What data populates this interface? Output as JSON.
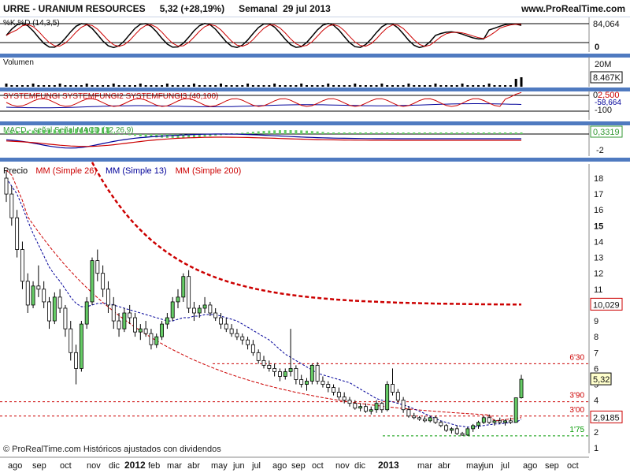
{
  "header": {
    "title": "URRE - URANIUM RESOURCES",
    "quote": "5,32 (+28,19%)",
    "period": "Semanal  29 jul 2013",
    "site": "www.ProRealTime.com"
  },
  "footer": "© ProRealTime.com Históricos ajustados con dividendos",
  "colors": {
    "panel_separator": "#4f7ac0",
    "up_candle": "#66cc66",
    "down_candle": "#ffffff",
    "ma26": "#cc0000",
    "ma13": "#000099",
    "ma200": "#cc0000",
    "volume": "#000000",
    "stoch_k": "#000000",
    "stoch_d": "#cc0000",
    "systemfungi2": "#cc0000",
    "systemfungi3": "#000099",
    "macd_hist": "#66cc66",
    "level_line": "#cc0000",
    "support_line": "#009900"
  },
  "chart_data": [
    {
      "type": "line",
      "panel": "stochastic",
      "title": "%K %D (14,3,5)",
      "yticks": [
        "84,064",
        "0"
      ],
      "last_value_label": "84,064",
      "series_names": [
        "%K",
        "%D"
      ]
    },
    {
      "type": "bar",
      "panel": "volume",
      "title": "Volumen",
      "yticks": [
        "20M"
      ],
      "last_value_label": "8.467K"
    },
    {
      "type": "line",
      "panel": "systemfungi",
      "title": "SYSTEMFUNGI SYSTEMFUNGI2 SYSTEMFUNGI3 (40,100)",
      "yticks": [
        "0",
        "-100"
      ],
      "labels": [
        "2,500",
        "-58,664"
      ]
    },
    {
      "type": "bar",
      "panel": "macd",
      "title": "MACD - señal Señal MACD (12,26,9)",
      "yticks": [
        "-2"
      ],
      "last_value_label": "0,3319"
    },
    {
      "type": "line",
      "panel": "price",
      "title": "Precio MM (Simple 26) MM (Simple 13) MM (Simple 200)",
      "legend": [
        "Precio",
        "MM (Simple 26)",
        "MM (Simple 13)",
        "MM (Simple 200)"
      ],
      "ylim": [
        1,
        18
      ],
      "yticks": [
        1,
        2,
        3,
        4,
        5,
        6,
        7,
        8,
        9,
        10,
        11,
        12,
        13,
        14,
        15,
        16,
        17,
        18
      ],
      "ytick_labels": [
        "1",
        "2",
        "3",
        "4",
        "5",
        "6",
        "7",
        "8",
        "9",
        "10",
        "11",
        "12",
        "13",
        "14",
        "15",
        "16",
        "17",
        "18"
      ],
      "last_price": "5,32",
      "ma200_last": "10,029",
      "ma26_last": "2,9185",
      "x_labels": [
        "ago",
        "sep",
        "oct",
        "nov",
        "dic",
        "2012",
        "feb",
        "mar",
        "abr",
        "may",
        "jun",
        "jul",
        "ago",
        "sep",
        "oct",
        "nov",
        "dic",
        "2013",
        "mar",
        "abr",
        "may",
        "jun",
        "jul",
        "ago",
        "sep",
        "oct"
      ],
      "horizontal_levels": [
        {
          "value": 6.3,
          "label": "6'30",
          "style": "red-dashed"
        },
        {
          "value": 3.9,
          "label": "3'90",
          "style": "red-dashed"
        },
        {
          "value": 3.0,
          "label": "3'00",
          "style": "red-dashed"
        },
        {
          "value": 1.75,
          "label": "1'75",
          "style": "green-dashed"
        }
      ],
      "ohlc_weekly": [
        [
          18.0,
          18.5,
          16.5,
          17.0
        ],
        [
          17.0,
          17.5,
          15.0,
          15.5
        ],
        [
          15.5,
          16.0,
          13.0,
          13.5
        ],
        [
          13.5,
          14.0,
          11.0,
          11.5
        ],
        [
          11.5,
          12.0,
          9.5,
          10.0
        ],
        [
          10.0,
          11.5,
          9.8,
          11.2
        ],
        [
          11.2,
          12.5,
          10.5,
          11.0
        ],
        [
          11.0,
          11.5,
          9.8,
          10.2
        ],
        [
          10.2,
          10.5,
          8.5,
          9.0
        ],
        [
          9.0,
          10.8,
          8.8,
          10.5
        ],
        [
          10.5,
          11.0,
          9.5,
          9.8
        ],
        [
          9.8,
          10.0,
          8.0,
          8.5
        ],
        [
          8.5,
          9.0,
          6.5,
          7.0
        ],
        [
          7.0,
          7.5,
          5.0,
          6.0
        ],
        [
          6.0,
          9.0,
          5.8,
          8.8
        ],
        [
          8.8,
          10.5,
          8.5,
          10.2
        ],
        [
          10.2,
          13.0,
          10.0,
          12.8
        ],
        [
          12.8,
          13.5,
          11.5,
          12.0
        ],
        [
          12.0,
          12.5,
          10.5,
          11.0
        ],
        [
          11.0,
          11.5,
          9.5,
          10.0
        ],
        [
          10.0,
          10.5,
          8.5,
          9.0
        ],
        [
          9.0,
          9.5,
          8.0,
          8.5
        ],
        [
          8.5,
          9.8,
          8.3,
          9.5
        ],
        [
          9.5,
          10.0,
          8.8,
          9.2
        ],
        [
          9.2,
          9.5,
          8.0,
          8.3
        ],
        [
          8.3,
          8.8,
          7.8,
          8.5
        ],
        [
          8.5,
          9.0,
          8.0,
          8.2
        ],
        [
          8.2,
          8.5,
          7.2,
          7.5
        ],
        [
          7.5,
          8.2,
          7.3,
          8.0
        ],
        [
          8.0,
          9.0,
          7.8,
          8.8
        ],
        [
          8.8,
          9.5,
          8.5,
          9.2
        ],
        [
          9.2,
          10.5,
          9.0,
          10.2
        ],
        [
          10.2,
          11.0,
          9.8,
          10.5
        ],
        [
          10.5,
          12.0,
          10.2,
          11.8
        ],
        [
          11.8,
          12.2,
          9.5,
          9.8
        ],
        [
          9.8,
          10.2,
          9.0,
          9.5
        ],
        [
          9.5,
          10.0,
          9.2,
          9.8
        ],
        [
          9.8,
          10.5,
          9.5,
          10.0
        ],
        [
          10.0,
          10.2,
          9.3,
          9.5
        ],
        [
          9.5,
          9.8,
          9.0,
          9.2
        ],
        [
          9.2,
          9.5,
          8.5,
          8.8
        ],
        [
          8.8,
          9.2,
          8.3,
          8.5
        ],
        [
          8.5,
          8.8,
          8.0,
          8.2
        ],
        [
          8.2,
          8.5,
          7.8,
          8.0
        ],
        [
          8.0,
          8.2,
          7.5,
          7.8
        ],
        [
          7.8,
          8.0,
          7.2,
          7.5
        ],
        [
          7.5,
          7.8,
          6.8,
          7.0
        ],
        [
          7.0,
          7.2,
          6.3,
          6.5
        ],
        [
          6.5,
          6.8,
          6.0,
          6.2
        ],
        [
          6.2,
          6.5,
          5.8,
          6.0
        ],
        [
          6.0,
          6.3,
          5.5,
          5.8
        ],
        [
          5.8,
          6.0,
          5.2,
          5.5
        ],
        [
          5.5,
          6.0,
          5.3,
          5.8
        ],
        [
          5.8,
          8.5,
          5.5,
          6.0
        ],
        [
          6.0,
          6.2,
          5.0,
          5.3
        ],
        [
          5.3,
          5.6,
          4.8,
          5.0
        ],
        [
          5.0,
          5.4,
          4.6,
          5.2
        ],
        [
          5.2,
          6.3,
          5.0,
          6.2
        ],
        [
          6.2,
          6.4,
          5.0,
          5.2
        ],
        [
          5.2,
          5.5,
          4.8,
          5.0
        ],
        [
          5.0,
          5.2,
          4.5,
          4.8
        ],
        [
          4.8,
          5.0,
          4.3,
          4.5
        ],
        [
          4.5,
          4.8,
          4.0,
          4.2
        ],
        [
          4.2,
          4.5,
          3.8,
          4.0
        ],
        [
          4.0,
          4.2,
          3.6,
          3.8
        ],
        [
          3.8,
          4.0,
          3.4,
          3.5
        ],
        [
          3.5,
          3.8,
          3.3,
          3.6
        ],
        [
          3.6,
          3.8,
          3.2,
          3.3
        ],
        [
          3.3,
          3.6,
          3.1,
          3.4
        ],
        [
          3.4,
          4.0,
          3.2,
          3.8
        ],
        [
          3.8,
          3.9,
          3.2,
          3.4
        ],
        [
          3.4,
          5.2,
          3.3,
          5.0
        ],
        [
          5.0,
          6.0,
          4.3,
          4.5
        ],
        [
          4.5,
          4.7,
          3.8,
          4.0
        ],
        [
          4.0,
          4.2,
          3.2,
          3.4
        ],
        [
          3.4,
          3.6,
          2.9,
          3.0
        ],
        [
          3.0,
          3.2,
          2.8,
          2.9
        ],
        [
          2.9,
          3.0,
          2.7,
          2.8
        ],
        [
          2.8,
          3.0,
          2.6,
          2.7
        ],
        [
          2.7,
          3.0,
          2.6,
          2.9
        ],
        [
          2.9,
          3.0,
          2.5,
          2.6
        ],
        [
          2.6,
          2.7,
          2.3,
          2.4
        ],
        [
          2.4,
          2.5,
          2.0,
          2.1
        ],
        [
          2.1,
          2.3,
          1.9,
          2.2
        ],
        [
          2.2,
          2.4,
          1.8,
          1.9
        ],
        [
          1.9,
          2.0,
          1.75,
          1.8
        ],
        [
          1.8,
          2.3,
          1.75,
          2.2
        ],
        [
          2.2,
          2.5,
          2.0,
          2.4
        ],
        [
          2.4,
          2.7,
          2.2,
          2.6
        ],
        [
          2.6,
          3.0,
          2.5,
          2.9
        ],
        [
          2.9,
          3.1,
          2.5,
          2.6
        ],
        [
          2.6,
          2.8,
          2.4,
          2.7
        ],
        [
          2.7,
          2.9,
          2.5,
          2.6
        ],
        [
          2.6,
          2.8,
          2.4,
          2.7
        ],
        [
          2.7,
          2.9,
          2.5,
          2.6
        ],
        [
          2.6,
          4.15,
          2.6,
          4.15
        ],
        [
          4.15,
          5.6,
          4.1,
          5.32
        ]
      ],
      "ma13_weekly": [
        18.0,
        17.5,
        17.0,
        16.2,
        15.3,
        14.5,
        13.8,
        13.1,
        12.4,
        11.9,
        11.5,
        11.0,
        10.5,
        10.1,
        9.9,
        9.9,
        10.0,
        10.1,
        10.1,
        10.1,
        10.0,
        9.9,
        9.8,
        9.7,
        9.6,
        9.5,
        9.4,
        9.3,
        9.2,
        9.1,
        9.0,
        9.0,
        9.1,
        9.2,
        9.2,
        9.3,
        9.3,
        9.4,
        9.4,
        9.4,
        9.3,
        9.2,
        9.1,
        9.0,
        8.8,
        8.6,
        8.4,
        8.2,
        8.0,
        7.8,
        7.5,
        7.2,
        6.9,
        6.7,
        6.5,
        6.3,
        6.1,
        5.9,
        5.7,
        5.6,
        5.5,
        5.4,
        5.3,
        5.2,
        5.1,
        4.9,
        4.7,
        4.5,
        4.3,
        4.1,
        4.0,
        3.95,
        3.9,
        3.8,
        3.7,
        3.6,
        3.45,
        3.3,
        3.15,
        3.0,
        2.85,
        2.7,
        2.6,
        2.5,
        2.4,
        2.35,
        2.3,
        2.3,
        2.35,
        2.4,
        2.45,
        2.5,
        2.5,
        2.55,
        2.6,
        2.6,
        2.8
      ],
      "ma26_weekly": [
        null,
        null,
        null,
        null,
        null,
        null,
        null,
        null,
        null,
        null,
        null,
        null,
        null,
        null,
        null,
        null,
        null,
        null,
        null,
        null,
        null,
        null,
        null,
        null,
        null,
        null,
        null,
        null,
        null,
        null,
        null,
        null,
        null,
        null,
        null,
        null,
        null,
        null,
        null,
        null,
        null,
        null,
        null,
        null,
        null,
        null,
        null,
        null,
        null,
        null,
        null,
        null,
        null,
        null,
        null,
        null,
        null,
        null,
        null,
        null,
        null,
        null,
        null,
        null,
        null,
        null,
        null,
        null,
        null,
        null,
        null,
        null,
        null,
        null,
        null,
        null,
        null,
        null,
        null,
        null,
        null,
        null,
        null,
        null,
        null,
        null,
        null,
        null,
        null,
        null,
        null,
        null,
        null,
        null,
        null,
        null,
        null
      ],
      "ma200_weekly_note": "",
      "ma200_weekly": [
        null,
        null,
        null,
        null,
        null,
        null,
        null,
        null,
        null,
        null,
        null,
        null,
        null,
        null,
        null,
        null,
        null,
        null,
        null,
        null,
        null,
        null,
        null,
        null,
        null,
        null,
        null,
        null,
        null,
        null,
        null,
        null,
        null,
        null,
        null,
        null,
        null,
        null,
        null,
        null,
        null,
        null,
        null,
        null,
        null,
        null,
        null,
        null,
        null,
        null,
        null,
        null,
        null,
        null,
        null,
        null,
        null,
        null,
        null,
        null,
        null,
        null,
        null,
        null,
        null,
        null,
        null,
        null,
        null,
        null,
        null,
        null,
        null,
        null,
        null,
        null,
        null,
        null,
        null,
        null,
        null,
        null,
        null,
        null,
        null,
        null,
        null,
        null,
        null,
        null,
        null,
        null,
        null,
        null,
        null,
        null,
        null
      ]
    }
  ]
}
